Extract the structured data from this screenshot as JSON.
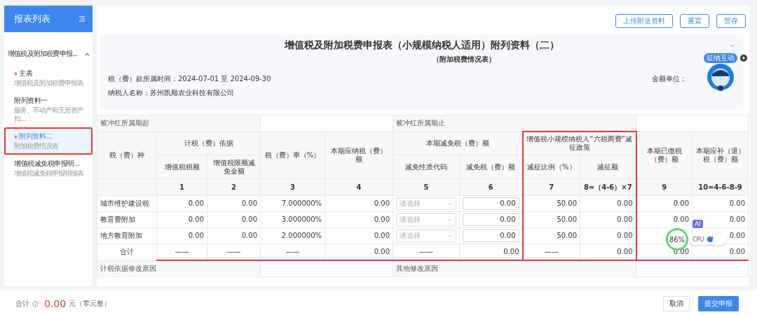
{
  "sidebar": {
    "title": "报表列表",
    "group": {
      "label": "增值税及附加税费申报...",
      "expanded": true,
      "items": [
        {
          "label": "主表",
          "sub": "增值税及附加税费申报表",
          "required": true,
          "selected": false
        },
        {
          "label": "附列资料一",
          "sub": "服务、不动产和无形资产扣...",
          "required": false,
          "selected": false
        },
        {
          "label": "附列资料二",
          "sub": "附加税费情况表",
          "required": true,
          "selected": true
        },
        {
          "label": "增值税减免税申报明...",
          "sub": "增值税减免税申报明细表",
          "required": false,
          "selected": false
        }
      ]
    }
  },
  "toolbar": {
    "buttons": [
      {
        "label": "上传附送资料"
      },
      {
        "label": "重置"
      },
      {
        "label": "暂存"
      }
    ]
  },
  "form": {
    "title": "增值税及附加税费申报表（小规模纳税人适用）附列资料（二）",
    "subtitle": "（附加税费情况表）",
    "period": "税（费）款所属时间：2024-07-01 至 2024-09-30",
    "taxpayer": "纳税人名称：苏州凯顺农业科技有限公司",
    "amount_unit": "金额单位：",
    "assistant_badge": "征纳互动"
  },
  "table": {
    "period_start": "被冲红所属期起",
    "period_end": "被冲红所属期止",
    "headers": {
      "tax_type": "税（费）种",
      "basis": "计税（费）依据",
      "basis_vat": "增值税税额",
      "basis_limit": "增值税限额减免金额",
      "rate": "税（费）率（%）",
      "payable": "本期应纳税（费）额",
      "relief": "本期减免税（费）额",
      "relief_code": "减免性质代码",
      "relief_amount": "减免税（费）额",
      "policy": "增值税小规模纳税人“六税两费”减征政策",
      "policy_ratio": "减征比例（%）",
      "policy_amount": "减征额",
      "paid": "本期已缴税（费）额",
      "due": "本期应补（退）税（费）额"
    },
    "numbers": [
      "1",
      "2",
      "3",
      "4",
      "5",
      "6",
      "7",
      "8=（4-6）×7",
      "9",
      "10=4-6-8-9"
    ],
    "rows": [
      {
        "name": "城市维护建设税",
        "total": false,
        "cells": [
          {
            "kind": "text",
            "value": "0.00"
          },
          {
            "kind": "text",
            "value": "0.00"
          },
          {
            "kind": "text",
            "value": "7.000000%"
          },
          {
            "kind": "text",
            "value": "0.00"
          },
          {
            "kind": "select",
            "placeholder": "请选择"
          },
          {
            "kind": "input",
            "value": "0.00"
          },
          {
            "kind": "text",
            "value": "50.00"
          },
          {
            "kind": "text",
            "value": "0.00"
          },
          {
            "kind": "text",
            "value": "0.00"
          },
          {
            "kind": "text",
            "value": "0.00"
          }
        ]
      },
      {
        "name": "教育费附加",
        "total": false,
        "cells": [
          {
            "kind": "text",
            "value": "0.00"
          },
          {
            "kind": "text",
            "value": "0.00"
          },
          {
            "kind": "text",
            "value": "3.000000%"
          },
          {
            "kind": "text",
            "value": "0.00"
          },
          {
            "kind": "select",
            "placeholder": "请选择"
          },
          {
            "kind": "input",
            "value": "0.00"
          },
          {
            "kind": "text",
            "value": "50.00"
          },
          {
            "kind": "text",
            "value": "0.00"
          },
          {
            "kind": "text",
            "value": "0.00"
          },
          {
            "kind": "text",
            "value": "0.00"
          }
        ]
      },
      {
        "name": "地方教育附加",
        "total": false,
        "cells": [
          {
            "kind": "text",
            "value": "0.00"
          },
          {
            "kind": "text",
            "value": "0.00"
          },
          {
            "kind": "text",
            "value": "2.000000%"
          },
          {
            "kind": "text",
            "value": "0.00"
          },
          {
            "kind": "select",
            "placeholder": "请选择"
          },
          {
            "kind": "input",
            "value": "0.00"
          },
          {
            "kind": "text",
            "value": "50.00"
          },
          {
            "kind": "text",
            "value": "0.00"
          },
          {
            "kind": "covered"
          },
          {
            "kind": "text",
            "value": "0.00"
          }
        ]
      },
      {
        "name": "合计",
        "total": true,
        "cells": [
          {
            "kind": "text",
            "value": "——"
          },
          {
            "kind": "text",
            "value": "——"
          },
          {
            "kind": "text",
            "value": "——"
          },
          {
            "kind": "text",
            "value": "0.00"
          },
          {
            "kind": "text",
            "value": "——"
          },
          {
            "kind": "text",
            "value": "0.00"
          },
          {
            "kind": "text",
            "value": "——"
          },
          {
            "kind": "text",
            "value": "0.00"
          },
          {
            "kind": "text",
            "value": "0.00"
          },
          {
            "kind": "text",
            "value": "0.00"
          }
        ]
      }
    ],
    "basis_reason": "计税依据修改原因",
    "other_reason": "其他修改原因"
  },
  "monitor": {
    "percent": "86%",
    "ai": "AI",
    "cpu": "CPU"
  },
  "footer": {
    "total_label": "合计",
    "amount": "0.00",
    "unit": "元（零元整）",
    "buttons": [
      {
        "label": "取消",
        "primary": false
      },
      {
        "label": "提交申报",
        "primary": true
      }
    ]
  }
}
